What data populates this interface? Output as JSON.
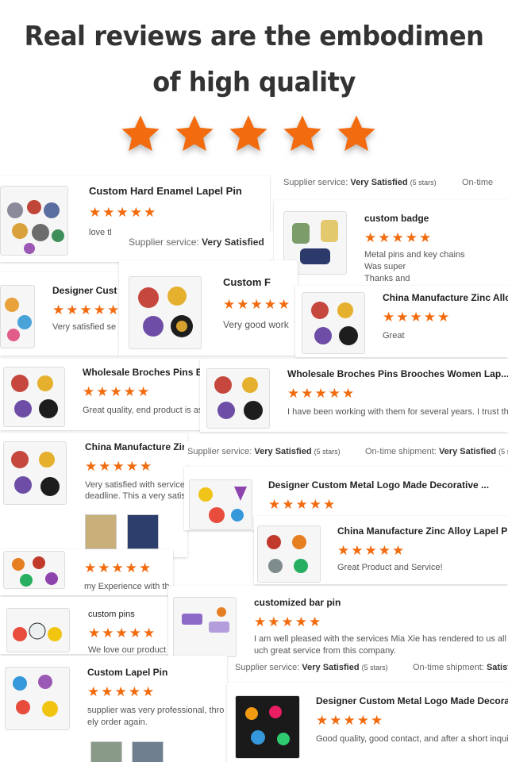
{
  "headline": {
    "line1": "Real reviews are the embodimen",
    "line2": "of high quality"
  },
  "colors": {
    "star": "#f26b0f",
    "text": "#333333"
  },
  "star_icon": "star-icon",
  "reviews": [
    {
      "title": "Custom Hard Enamel Lapel Pin",
      "rating": 5,
      "text": "love tl"
    },
    {
      "title": "custom badge",
      "rating": 5,
      "text": "Metal pins and key chains",
      "text2": "Was super",
      "text3": "Thanks  and"
    },
    {
      "title": "Designer Cust",
      "rating": 5,
      "text": "Very satisfied se"
    },
    {
      "title": "Custom F",
      "rating": 5,
      "text": "Very good work"
    },
    {
      "title": "China Manufacture Zinc Allo",
      "rating": 5,
      "text": "Great"
    },
    {
      "title": "Wholesale Broches Pins B",
      "rating": 5,
      "text": "Great quality, end product is as"
    },
    {
      "title": "Wholesale Broches Pins Brooches Women Lap...",
      "rating": 5,
      "text": "I have been working with them for several years. I trust the"
    },
    {
      "title": "China Manufacture Zir",
      "rating": 5,
      "text": "Very satisfied with service",
      "text2": "deadline.  This a very satis"
    },
    {
      "title": "Designer Custom Metal Logo Made Decorative ...",
      "rating": 5
    },
    {
      "title": "China Manufacture Zinc Alloy Lapel Pi",
      "rating": 5,
      "text": "Great Product and Service!"
    },
    {
      "title": "",
      "rating": 5,
      "text": "my Experience with th"
    },
    {
      "title": "custom pins",
      "rating": 5,
      "text": "We love our product"
    },
    {
      "title": "customized bar pin",
      "rating": 5,
      "text": "I am well pleased with the services Mia Xie has rendered to us all t",
      "text2": "uch great service from this company."
    },
    {
      "title": "Custom Lapel Pin",
      "rating": 5,
      "text": "supplier was very professional, thro",
      "text2": "ely order again."
    },
    {
      "title": "Designer Custom Metal Logo Made Decora",
      "rating": 5,
      "text": "Good quality, good contact, and after a short inqui"
    }
  ],
  "service_bars": [
    {
      "label": "Supplier service:",
      "value": "Very Satisfied",
      "stars": "(5 stars)",
      "label2": "On-time",
      "value2": "",
      "stars2": ""
    },
    {
      "label": "Supplier service:",
      "value": "Very Satisfied",
      "stars": "",
      "label2": "",
      "value2": "",
      "stars2": ""
    },
    {
      "label": "Supplier service:",
      "value": "Very Satisfied",
      "stars": "(5 stars)",
      "label2": "On-time shipment:",
      "value2": "Very Satisfied",
      "stars2": "(5 s"
    },
    {
      "label": "Supplier service:",
      "value": "Very Satisfied",
      "stars": "(5 stars)",
      "label2": "On-time shipment:",
      "value2": "Satisf",
      "stars2": ""
    }
  ]
}
